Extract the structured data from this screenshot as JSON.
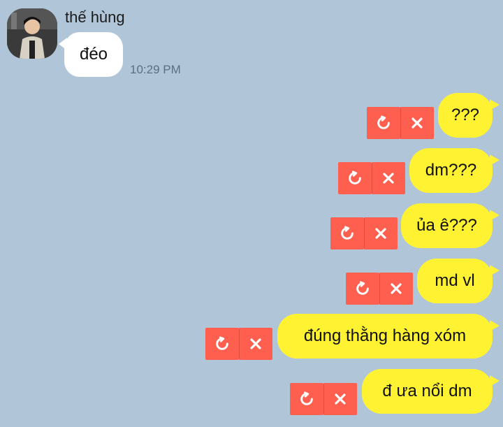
{
  "incoming": {
    "sender_name": "thế hùng",
    "message": "đéo",
    "time": "10:29 PM"
  },
  "outgoing": [
    {
      "text": "???"
    },
    {
      "text": "dm???"
    },
    {
      "text": "ủa ê???"
    },
    {
      "text": "md vl"
    },
    {
      "text": "đúng thằng hàng xóm"
    },
    {
      "text": "đ ưa nổi dm"
    }
  ],
  "colors": {
    "background": "#b1c5d9",
    "outgoing_bubble": "#fef232",
    "incoming_bubble": "#ffffff",
    "failed_action": "#ff5f4e"
  },
  "icons": {
    "retry": "retry-icon",
    "delete": "close-icon"
  }
}
